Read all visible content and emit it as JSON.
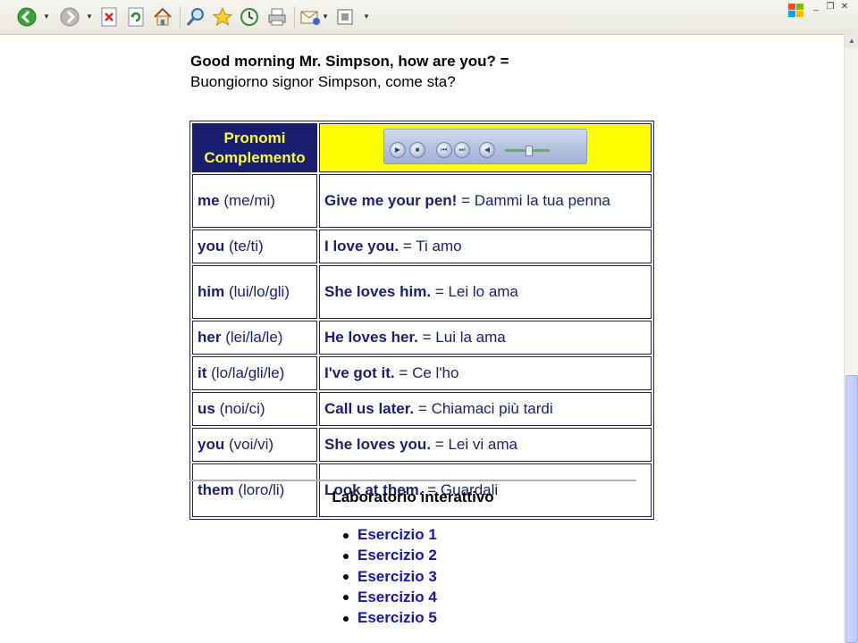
{
  "toolbar": {
    "buttons": [
      "back-icon",
      "forward-icon",
      "stop-icon",
      "refresh-icon",
      "home-icon",
      "search-icon",
      "favorites-icon",
      "history-icon",
      "print-icon",
      "mail-icon",
      "edit-icon"
    ]
  },
  "greeting": {
    "english": "Good morning Mr. Simpson, how are you?",
    "equals": "=",
    "italian": "Buongiorno signor Simpson, come sta?"
  },
  "table": {
    "header": {
      "line1": "Pronomi",
      "line2": "Complemento"
    },
    "rows": [
      {
        "pronoun": "me",
        "translation": "(me/mi)",
        "example": "Give me your pen!",
        "equals": "=",
        "meaning": "Dammi la tua penna"
      },
      {
        "pronoun": "you",
        "translation": "(te/ti)",
        "example": "I love you.",
        "equals": "=",
        "meaning": "Ti amo"
      },
      {
        "pronoun": "him",
        "translation": "(lui/lo/gli)",
        "example": "She loves him.",
        "equals": "=",
        "meaning": "Lei lo ama"
      },
      {
        "pronoun": "her",
        "translation": "(lei/la/le)",
        "example": "He loves her.",
        "equals": "=",
        "meaning": "Lui la ama"
      },
      {
        "pronoun": "it",
        "translation": "(lo/la/gli/le)",
        "example": "I've got it.",
        "equals": "=",
        "meaning": "Ce l'ho"
      },
      {
        "pronoun": "us",
        "translation": "(noi/ci)",
        "example": "Call us later.",
        "equals": "=",
        "meaning": "Chiamaci più tardi"
      },
      {
        "pronoun": "you",
        "translation": "(voi/vi)",
        "example": "She loves you.",
        "equals": "=",
        "meaning": "Lei vi ama"
      },
      {
        "pronoun": "them",
        "translation": "(loro/li)",
        "example": "Look at them.",
        "equals": "=",
        "meaning": "Guardali"
      }
    ]
  },
  "lab": {
    "title": "Laboratorio interattivo",
    "exercises": [
      "Esercizio 1",
      "Esercizio 2",
      "Esercizio 3",
      "Esercizio 4",
      "Esercizio 5"
    ]
  },
  "colors": {
    "navy": "#1a1e6e",
    "header_yellow": "#ffff00",
    "header_text": "#ffff33",
    "link": "#1515b5"
  }
}
